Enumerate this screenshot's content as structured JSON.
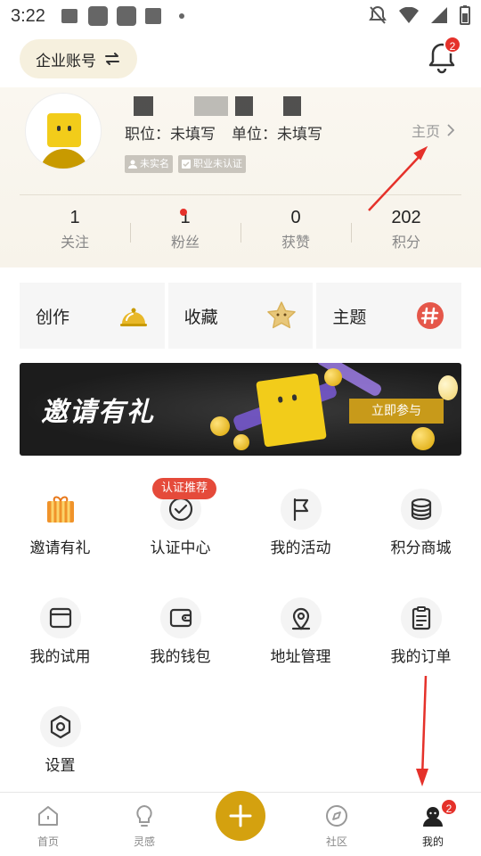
{
  "status_bar": {
    "time": "3:22"
  },
  "header": {
    "account_label": "企业账号",
    "notification_count": "2"
  },
  "profile": {
    "position_label": "职位：",
    "position_value": "未填写",
    "unit_label": "单位：",
    "unit_value": "未填写",
    "homepage_label": "主页",
    "tags": [
      "未实名",
      "职业未认证"
    ],
    "stats": [
      {
        "value": "1",
        "label": "关注"
      },
      {
        "value": "1",
        "label": "粉丝"
      },
      {
        "value": "0",
        "label": "获赞"
      },
      {
        "value": "202",
        "label": "积分"
      }
    ]
  },
  "quick_cards": [
    {
      "label": "创作",
      "icon": "cloche-icon"
    },
    {
      "label": "收藏",
      "icon": "star-icon"
    },
    {
      "label": "主题",
      "icon": "hashtag-icon"
    }
  ],
  "banner": {
    "title": "邀请有礼",
    "button": "立即参与"
  },
  "menu": {
    "items": [
      {
        "label": "邀请有礼",
        "icon": "gift-icon"
      },
      {
        "label": "认证中心",
        "icon": "check-circle-icon",
        "badge": "认证推荐"
      },
      {
        "label": "我的活动",
        "icon": "flag-icon"
      },
      {
        "label": "积分商城",
        "icon": "coins-icon"
      },
      {
        "label": "我的试用",
        "icon": "window-icon"
      },
      {
        "label": "我的钱包",
        "icon": "wallet-icon"
      },
      {
        "label": "地址管理",
        "icon": "location-pin-icon"
      },
      {
        "label": "我的订单",
        "icon": "clipboard-icon"
      },
      {
        "label": "设置",
        "icon": "settings-hexagon-icon"
      }
    ]
  },
  "bottom_nav": {
    "items": [
      {
        "label": "首页",
        "icon": "home-icon"
      },
      {
        "label": "灵感",
        "icon": "lightbulb-icon"
      },
      {
        "label": "",
        "icon": "plus-icon"
      },
      {
        "label": "社区",
        "icon": "compass-icon"
      },
      {
        "label": "我的",
        "icon": "profile-icon",
        "badge": "2"
      }
    ]
  },
  "colors": {
    "accent": "#d4a10f",
    "badge": "#e5312a",
    "annotation": "#e5312a"
  }
}
